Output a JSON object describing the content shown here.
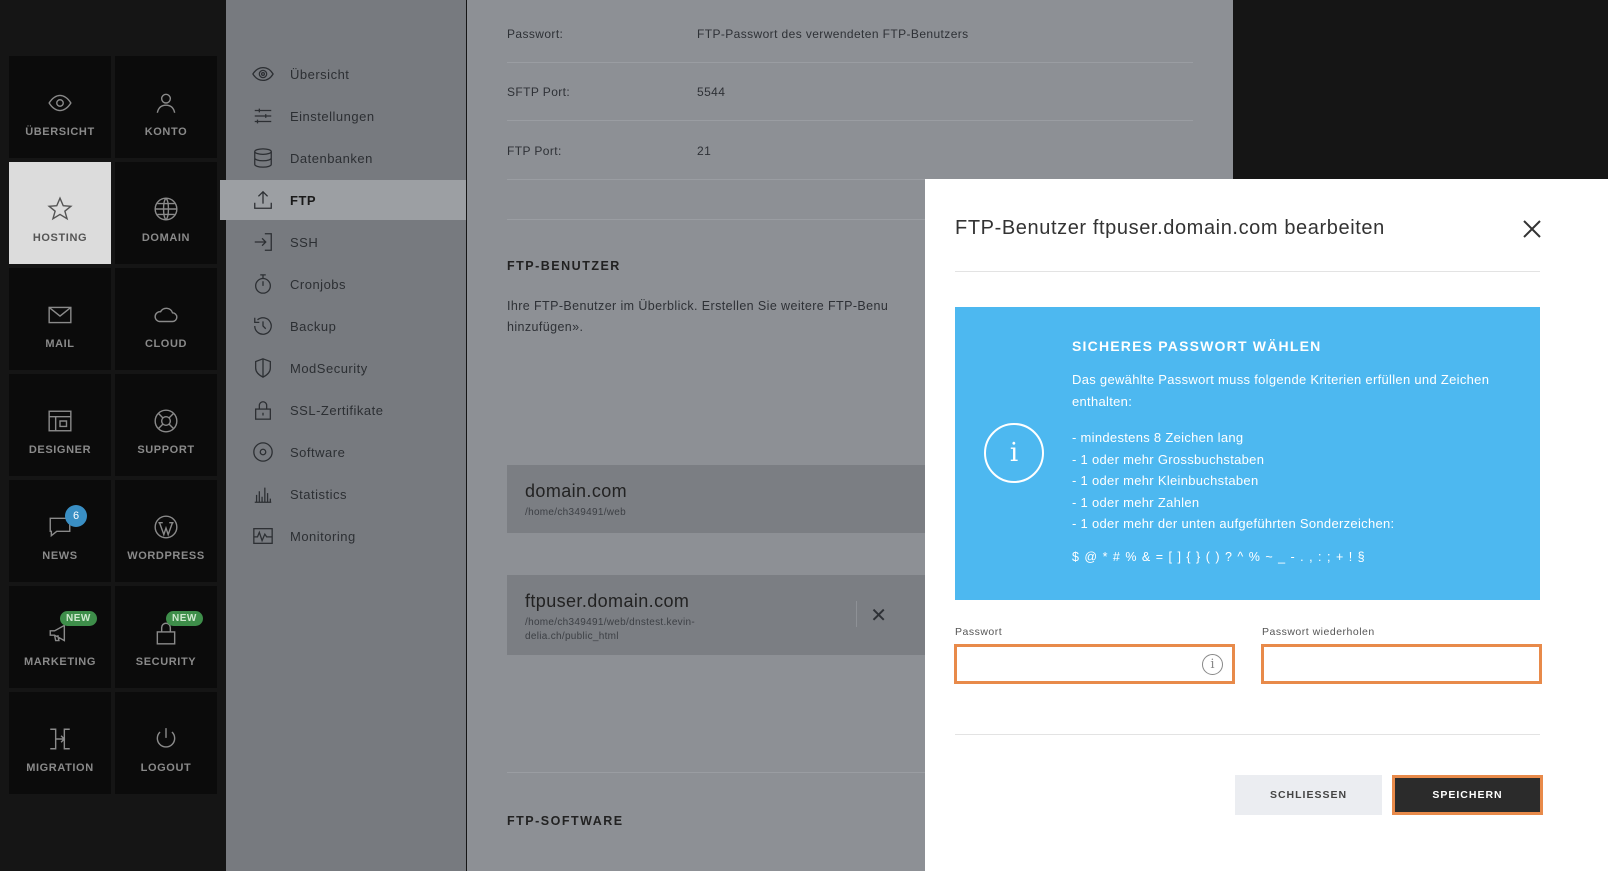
{
  "nav": {
    "tiles": [
      {
        "label": "ÜBERSICHT",
        "icon": "eye-icon"
      },
      {
        "label": "KONTO",
        "icon": "user-icon"
      },
      {
        "label": "HOSTING",
        "icon": "star-icon",
        "active": true
      },
      {
        "label": "DOMAIN",
        "icon": "globe-icon"
      },
      {
        "label": "MAIL",
        "icon": "mail-icon"
      },
      {
        "label": "CLOUD",
        "icon": "cloud-icon"
      },
      {
        "label": "DESIGNER",
        "icon": "layout-icon"
      },
      {
        "label": "SUPPORT",
        "icon": "lifebuoy-icon"
      },
      {
        "label": "NEWS",
        "icon": "chat-icon",
        "badge": "6"
      },
      {
        "label": "WORDPRESS",
        "icon": "wordpress-icon"
      },
      {
        "label": "MARKETING",
        "icon": "megaphone-icon",
        "badge": "NEW"
      },
      {
        "label": "SECURITY",
        "icon": "lock-icon",
        "badge": "NEW"
      },
      {
        "label": "MIGRATION",
        "icon": "migration-icon"
      },
      {
        "label": "LOGOUT",
        "icon": "power-icon"
      }
    ]
  },
  "subnav": {
    "items": [
      {
        "label": "Übersicht",
        "icon": "eye-icon"
      },
      {
        "label": "Einstellungen",
        "icon": "sliders-icon"
      },
      {
        "label": "Datenbanken",
        "icon": "database-icon"
      },
      {
        "label": "FTP",
        "icon": "upload-icon",
        "active": true
      },
      {
        "label": "SSH",
        "icon": "login-icon"
      },
      {
        "label": "Cronjobs",
        "icon": "stopwatch-icon"
      },
      {
        "label": "Backup",
        "icon": "history-icon"
      },
      {
        "label": "ModSecurity",
        "icon": "shield-icon"
      },
      {
        "label": "SSL-Zertifikate",
        "icon": "padlock-icon"
      },
      {
        "label": "Software",
        "icon": "disc-icon"
      },
      {
        "label": "Statistics",
        "icon": "bar-chart-icon"
      },
      {
        "label": "Monitoring",
        "icon": "pulse-icon"
      }
    ]
  },
  "main": {
    "rows": [
      {
        "label": "Passwort:",
        "value": "FTP-Passwort des verwendeten FTP-Benutzers"
      },
      {
        "label": "SFTP Port:",
        "value": "5544"
      },
      {
        "label": "FTP Port:",
        "value": "21"
      }
    ],
    "ftp_users_heading": "FTP-BENUTZER",
    "ftp_users_text_line1": "Ihre FTP-Benutzer im Überblick. Erstellen Sie weitere FTP-Benu",
    "ftp_users_text_line2": "hinzufügen».",
    "cards": [
      {
        "title": "domain.com",
        "path": "/home/ch349491/web"
      },
      {
        "title": "ftpuser.domain.com",
        "path": "/home/ch349491/web/dnstest.kevin-delia.ch/public_html"
      }
    ],
    "ftp_software_heading": "FTP-SOFTWARE"
  },
  "modal": {
    "title": "FTP-Benutzer ftpuser.domain.com bearbeiten",
    "info": {
      "title": "SICHERES PASSWORT WÄHLEN",
      "text": "Das gewählte Passwort muss folgende Kriterien erfüllen und Zeichen enthalten:",
      "criteria": [
        "- mindestens 8 Zeichen lang",
        "- 1 oder mehr Grossbuchstaben",
        "- 1 oder mehr Kleinbuchstaben",
        "- 1 oder mehr Zahlen",
        "- 1 oder mehr der unten aufgeführten Sonderzeichen:"
      ],
      "special_chars": "$ @ * # % & = [ ] { } ( ) ? ^ % ~ _ - . , : ; + ! §"
    },
    "password_label": "Passwort",
    "password_value": "",
    "password_repeat_label": "Passwort wiederholen",
    "password_repeat_value": "",
    "close_button": "SCHLIESSEN",
    "save_button": "SPEICHERN"
  },
  "colors": {
    "accent_blue": "#4db8f0",
    "focus_orange": "#e88a4a",
    "badge_green": "#3e8e4a",
    "badge_blue": "#3a8fc4"
  }
}
